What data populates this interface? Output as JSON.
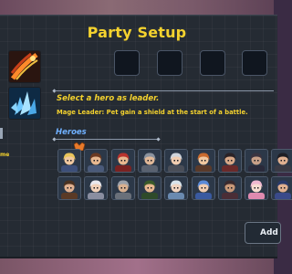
{
  "title": "Party Setup",
  "skills": [
    {
      "icon": "fire-slash-icon",
      "color": "#d9561c"
    },
    {
      "icon": "ice-crystal-icon",
      "color": "#4fb3ee"
    }
  ],
  "leader_slots_count": 4,
  "prompt": "Select a hero as leader.",
  "leader_description": "Mage Leader: Pet gain a shield at the start of a battle.",
  "heroes_label": "Heroes",
  "side_text": "me",
  "heroes_row1": [
    {
      "name": "hero-blonde-knight",
      "hair": "#e8c45a",
      "cloth": "#3d4f7a",
      "skin": "#f0c8a0"
    },
    {
      "name": "hero-brown-hair",
      "hair": "#6b3a22",
      "cloth": "#4a5a7a",
      "skin": "#e8b890"
    },
    {
      "name": "hero-red-hood",
      "hair": "#b8332e",
      "cloth": "#7a2222",
      "skin": "#e8b890"
    },
    {
      "name": "hero-grey-knight",
      "hair": "#8a929e",
      "cloth": "#5a6270",
      "skin": "#e0b898"
    },
    {
      "name": "hero-silver-hair",
      "hair": "#cfd4dc",
      "cloth": "#4a4e58",
      "skin": "#f0ccb0"
    },
    {
      "name": "hero-ginger-fighter",
      "hair": "#c86a2e",
      "cloth": "#5a3a2a",
      "skin": "#f0c8a0"
    },
    {
      "name": "hero-dark-rogue",
      "hair": "#2a2226",
      "cloth": "#6a2a2a",
      "skin": "#d8a888"
    },
    {
      "name": "hero-dark-mage",
      "hair": "#3a3440",
      "cloth": "#2a2a3a",
      "skin": "#c8a088"
    },
    {
      "name": "hero-black-hair",
      "hair": "#1e1e24",
      "cloth": "#3a3a44",
      "skin": "#e0b090"
    }
  ],
  "heroes_row2": [
    {
      "name": "hero-cowboy",
      "hair": "#4a3222",
      "cloth": "#5a3a26",
      "skin": "#e0b090"
    },
    {
      "name": "hero-white-mage",
      "hair": "#e8e8ee",
      "cloth": "#8a8ea0",
      "skin": "#f0d0b8"
    },
    {
      "name": "hero-steel-helm",
      "hair": "#9aa0aa",
      "cloth": "#6a707a",
      "skin": "#d8b090"
    },
    {
      "name": "hero-green-ranger",
      "hair": "#3a5a2a",
      "cloth": "#2e4a2a",
      "skin": "#e8b890"
    },
    {
      "name": "hero-frost-sorceress",
      "hair": "#d8e4ec",
      "cloth": "#6a8ab0",
      "skin": "#f0d4c0"
    },
    {
      "name": "hero-blue-cleric",
      "hair": "#5a8ad8",
      "cloth": "#3a5aa0",
      "skin": "#f0ccb0"
    },
    {
      "name": "hero-dark-assassin",
      "hair": "#3a2a2e",
      "cloth": "#4a2e36",
      "skin": "#c89878"
    },
    {
      "name": "hero-pink-bunny",
      "hair": "#f0b8d0",
      "cloth": "#e08ab0",
      "skin": "#f8dcd0"
    },
    {
      "name": "hero-blue-monk",
      "hair": "#2a3a6a",
      "cloth": "#3a4a8a",
      "skin": "#e0b090"
    }
  ],
  "add_button_label": "Add",
  "accent_color": "#f4d22e",
  "label_color": "#6fb0ff"
}
